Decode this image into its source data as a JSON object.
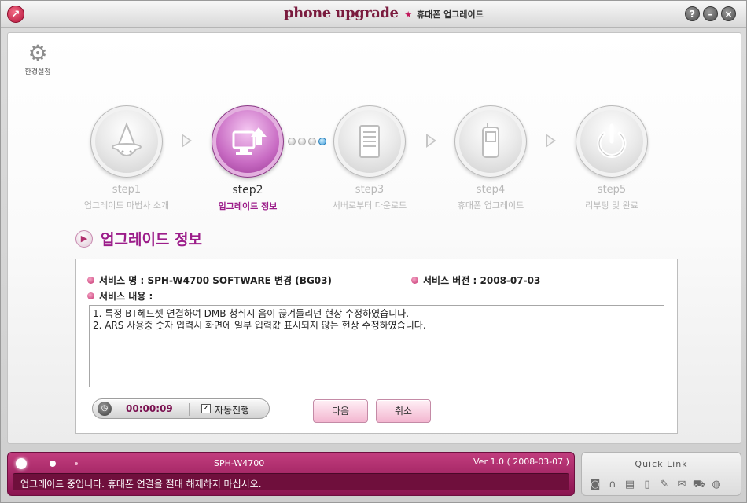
{
  "window": {
    "brand": "phone upgrade",
    "subtitle": "휴대폰 업그레이드",
    "help_label": "?",
    "min_label": "–",
    "close_label": "×"
  },
  "env": {
    "label": "환경설정"
  },
  "steps": [
    {
      "num": "step1",
      "label": "업그레이드 마법사 소개",
      "icon": "wizard-icon",
      "active": false
    },
    {
      "num": "step2",
      "label": "업그레이드 정보",
      "icon": "computer-upload-icon",
      "active": true
    },
    {
      "num": "step3",
      "label": "서버로부터 다운로드",
      "icon": "server-icon",
      "active": false
    },
    {
      "num": "step4",
      "label": "휴대폰 업그레이드",
      "icon": "mobile-phone-icon",
      "active": false
    },
    {
      "num": "step5",
      "label": "리부팅 및 완료",
      "icon": "power-icon",
      "active": false
    }
  ],
  "section": {
    "title": "업그레이드 정보"
  },
  "info": {
    "service_name": "서비스 명 : SPH-W4700 SOFTWARE 변경 (BG03)",
    "service_version": "서비스 버전 : 2008-07-03",
    "service_content_label": "서비스 내용 :",
    "content_lines": [
      "1. 특정 BT헤드셋 연결하여 DMB 청취시 음이 끊겨들리던 현상 수정하였습니다.",
      "2. ARS 사용중 숫자 입력시 화면에 일부 입력값 표시되지 않는 현상 수정하였습니다."
    ]
  },
  "timer": {
    "time": "00:00:09",
    "auto_label": "자동진행",
    "auto_checked": true
  },
  "buttons": {
    "next": "다음",
    "cancel": "취소"
  },
  "status": {
    "model": "SPH-W4700",
    "version": "Ver 1.0 ( 2008-03-07 )",
    "message": "업그레이드 중입니다. 휴대폰 연결을 절대 해제하지 마십시오."
  },
  "quick_link": {
    "title": "Quick Link",
    "icons": [
      "camera-icon",
      "headset-icon",
      "document-icon",
      "phone-icon",
      "notepad-icon",
      "mail-icon",
      "car-icon",
      "globe-icon"
    ]
  },
  "colors": {
    "accent": "#9c1d8a",
    "status_bg": "#8a1450"
  }
}
